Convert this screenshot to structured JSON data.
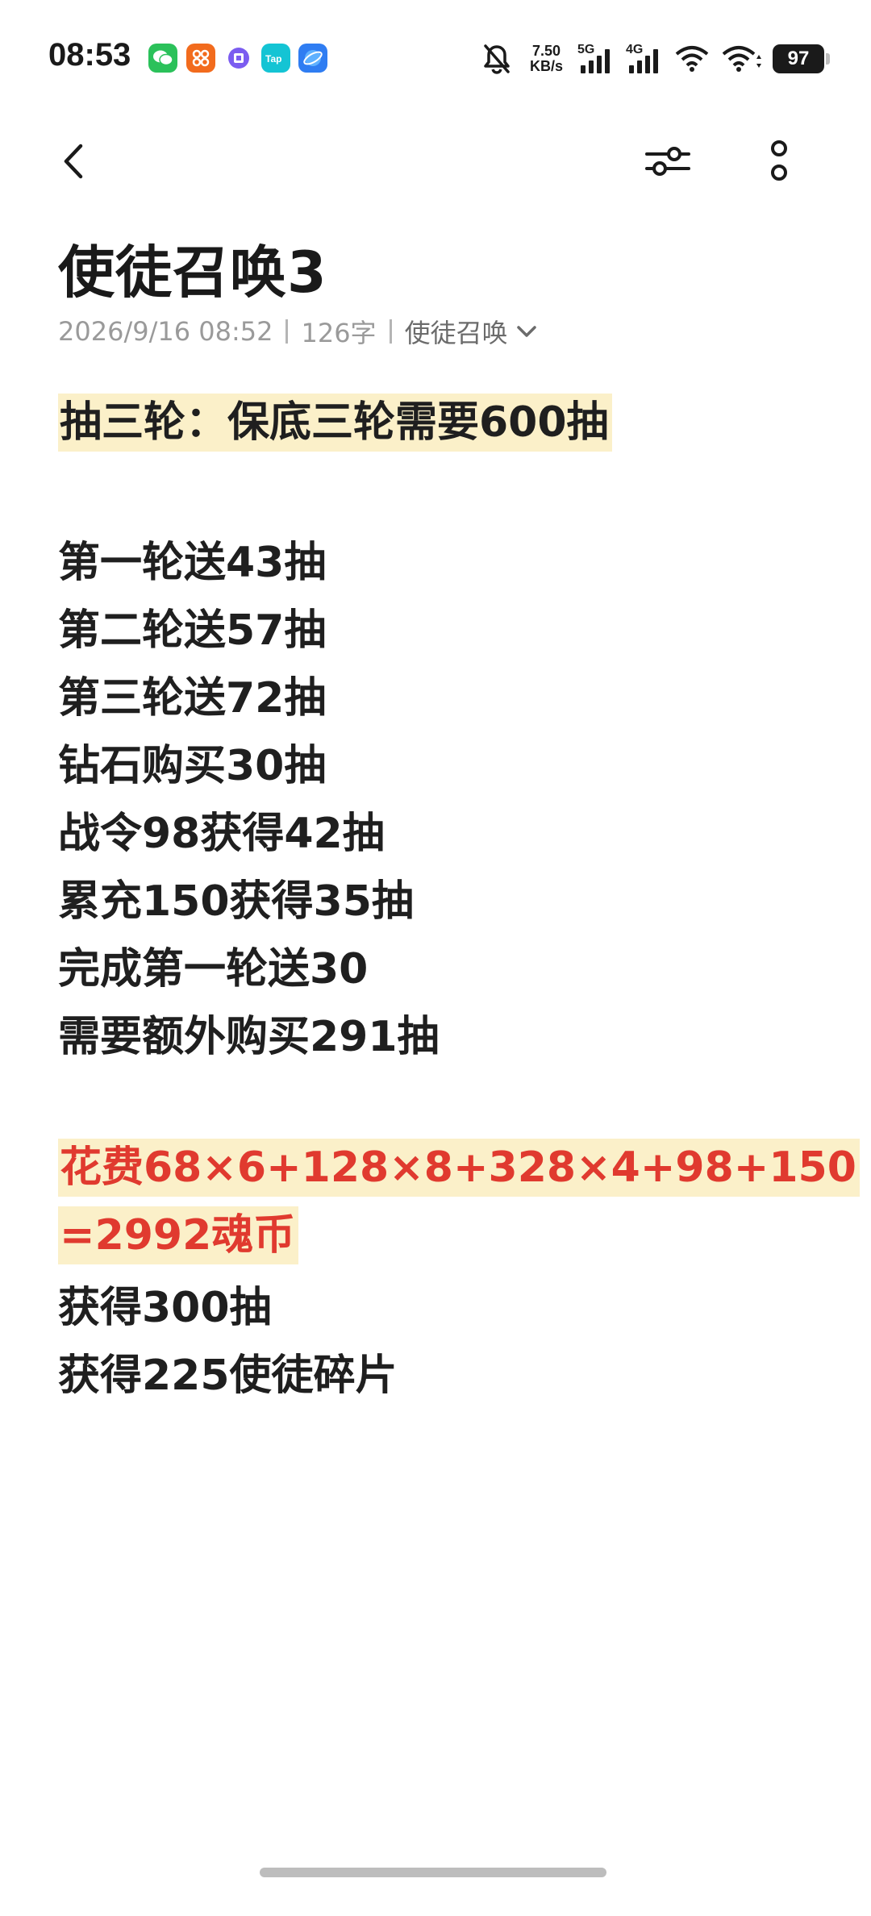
{
  "status_bar": {
    "time": "08:53",
    "net_speed_value": "7.50",
    "net_speed_unit": "KB/s",
    "sim1_label": "5G",
    "sim2_label": "4G",
    "battery": "97",
    "app_icons": [
      "wechat-icon",
      "taobao-style-app-icon",
      "tieba-icon",
      "taptap-icon",
      "browser-icon"
    ]
  },
  "toolbar": {
    "back_icon": "back-icon",
    "style_icon": "adjust-icon",
    "more_icon": "more-icon"
  },
  "note": {
    "title": "使徒召唤3",
    "date": "2026/9/16 08:52",
    "word_count": "126字",
    "folder": "使徒召唤",
    "lines": [
      "抽三轮：保底三轮需要600抽",
      "",
      "第一轮送43抽",
      "第二轮送57抽",
      "第三轮送72抽",
      "钻石购买30抽",
      "战令98获得42抽",
      "累充150获得35抽",
      "完成第一轮送30",
      "需要额外购买291抽",
      "",
      "花费68×6+128×8+328×4+98+150",
      "=2992魂币",
      "获得300抽",
      "获得225使徒碎片"
    ]
  },
  "colors": {
    "highlight": "#fbf0c9",
    "red_text": "#e03a2f",
    "meta_gray": "#9a9a9a"
  }
}
